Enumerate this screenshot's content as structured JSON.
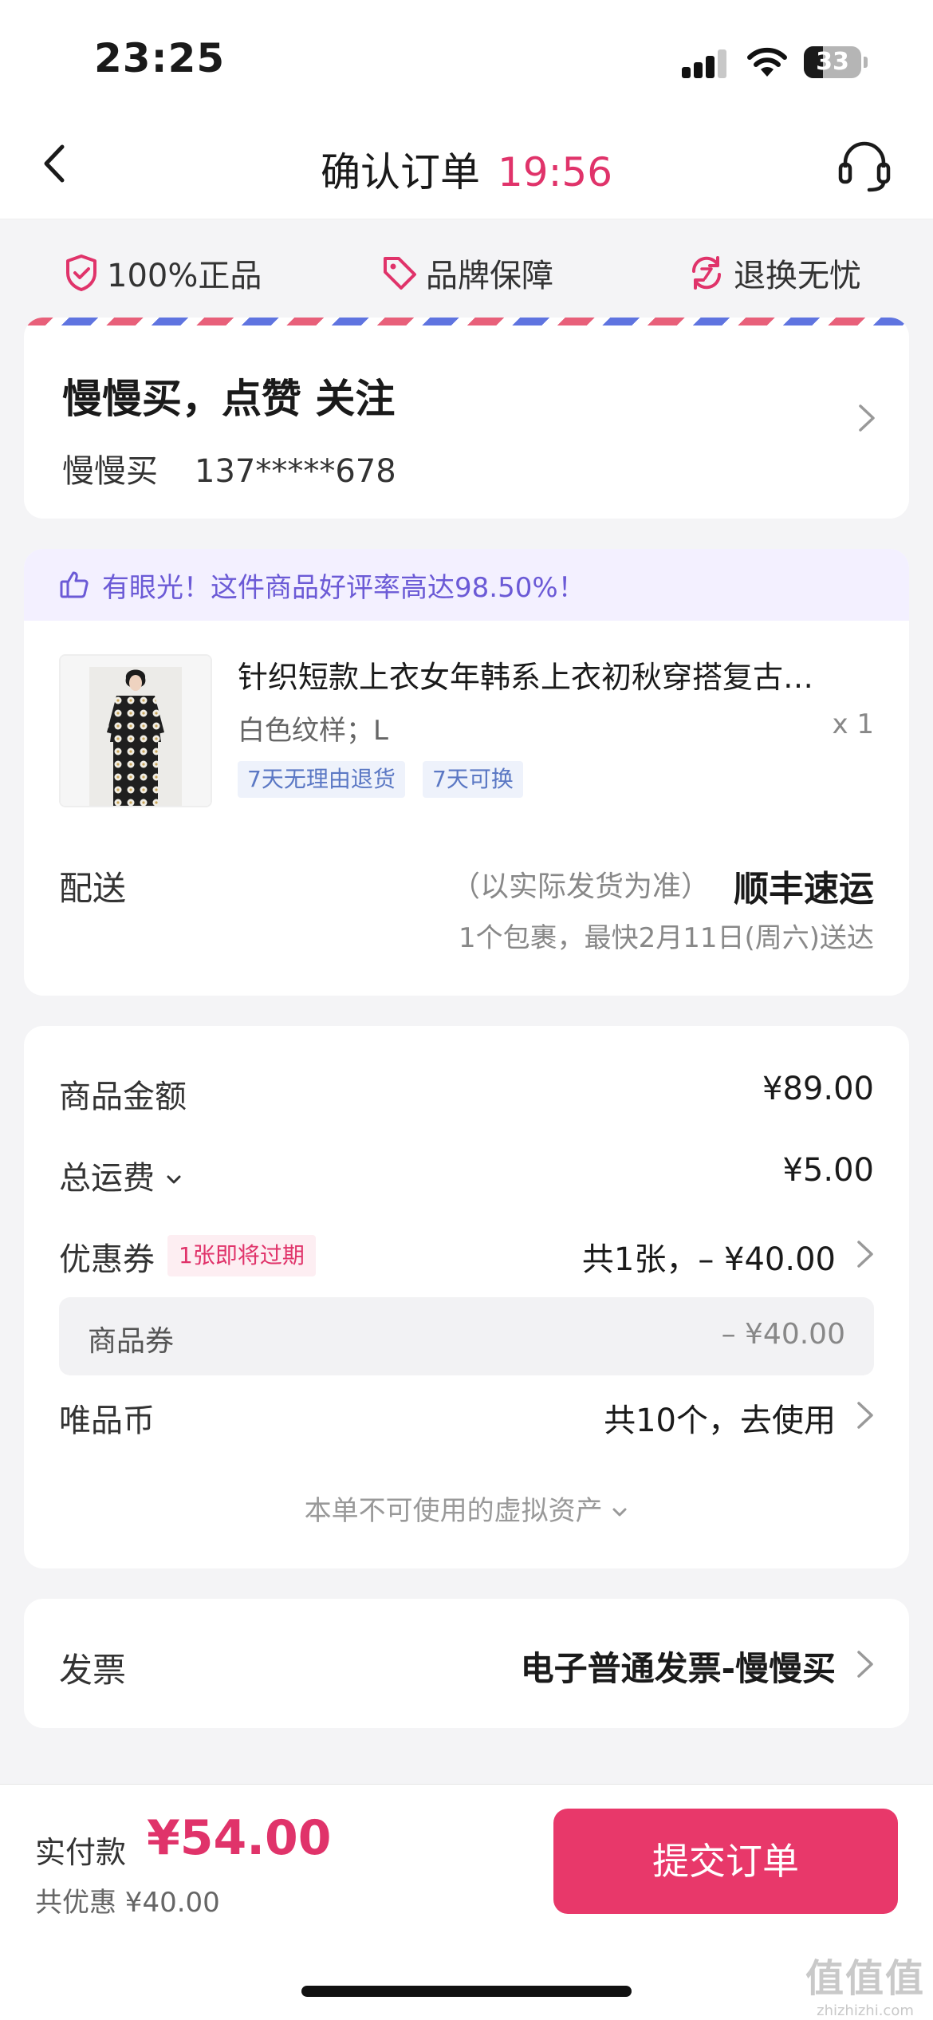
{
  "status_bar": {
    "time": "23:25",
    "battery": "33"
  },
  "nav": {
    "title": "确认订单",
    "countdown": "19:56"
  },
  "guarantees": [
    {
      "label": "100%正品",
      "icon": "shield-check-icon"
    },
    {
      "label": "品牌保障",
      "icon": "tag-icon"
    },
    {
      "label": "退换无忧",
      "icon": "return-exchange-icon"
    }
  ],
  "address": {
    "name": "慢慢买，点赞 关注",
    "receiver": "慢慢买",
    "phone": "137*****678"
  },
  "product": {
    "praise": "有眼光！这件商品好评率高达98.50%！",
    "title": "针织短款上衣女年韩系上衣初秋穿搭复古…",
    "spec": "白色纹样；L",
    "qty": "x 1",
    "tags": [
      "7天无理由退货",
      "7天可换"
    ]
  },
  "shipping": {
    "label": "配送",
    "note": "（以实际发货为准）",
    "carrier": "顺丰速运",
    "eta": "1个包裹，最快2月11日(周六)送达"
  },
  "price": {
    "goods_label": "商品金额",
    "goods_value": "¥89.00",
    "freight_label": "总运费",
    "freight_value": "¥5.00",
    "coupon_label": "优惠券",
    "coupon_badge": "1张即将过期",
    "coupon_value": "共1张，– ¥40.00",
    "goods_coupon_label": "商品券",
    "goods_coupon_value": "– ¥40.00",
    "coin_label": "唯品币",
    "coin_value": "共10个，去使用",
    "virtual_assets": "本单不可使用的虚拟资产"
  },
  "invoice": {
    "label": "发票",
    "value": "电子普通发票-慢慢买"
  },
  "bottom": {
    "pay_label": "实付款",
    "pay_amount": "¥54.00",
    "saved": "共优惠 ¥40.00",
    "submit": "提交订单"
  },
  "watermark": {
    "logo": "值值值",
    "url": "zhizhizhi.com"
  },
  "colors": {
    "accent": "#e8386a",
    "price_red": "#e0336a",
    "praise_purple": "#6b5ad6",
    "tag_blue": "#5b78c4"
  }
}
